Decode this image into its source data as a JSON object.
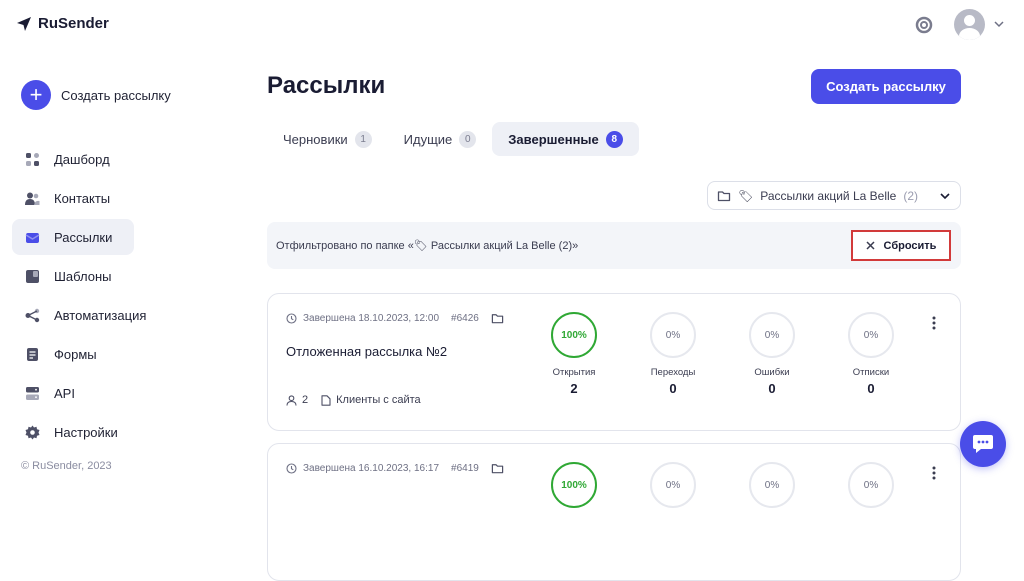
{
  "app": {
    "logo_text": "RuSender",
    "footer": "© RuSender, 2023"
  },
  "sidebar": {
    "create_label": "Создать рассылку",
    "items": [
      {
        "label": "Дашборд",
        "icon": "dashboard-icon"
      },
      {
        "label": "Контакты",
        "icon": "contacts-icon"
      },
      {
        "label": "Рассылки",
        "icon": "mailings-icon",
        "active": true
      },
      {
        "label": "Шаблоны",
        "icon": "templates-icon"
      },
      {
        "label": "Автоматизация",
        "icon": "automation-icon"
      },
      {
        "label": "Формы",
        "icon": "forms-icon"
      },
      {
        "label": "API",
        "icon": "api-icon"
      },
      {
        "label": "Настройки",
        "icon": "settings-icon"
      }
    ]
  },
  "main": {
    "title": "Рассылки",
    "create_button": "Создать рассылку",
    "tabs": [
      {
        "label": "Черновики",
        "count": "1"
      },
      {
        "label": "Идущие",
        "count": "0"
      },
      {
        "label": "Завершенные",
        "count": "8",
        "active": true
      }
    ],
    "folder_select": {
      "label": "Рассылки акций La Belle",
      "count": "(2)"
    },
    "filter_text": "Отфильтровано по папке «🏷 Рассылки акций La Belle (2)»",
    "reset_label": "Сбросить"
  },
  "campaigns": [
    {
      "status": "Завершена 18.10.2023, 12:00",
      "number": "#6426",
      "name": "Отложенная рассылка №2",
      "recipients": "2",
      "list": "Клиенты с сайта",
      "stats": [
        {
          "ring": "100%",
          "label": "Открытия",
          "value": "2"
        },
        {
          "ring": "0%",
          "label": "Переходы",
          "value": "0"
        },
        {
          "ring": "0%",
          "label": "Ошибки",
          "value": "0"
        },
        {
          "ring": "0%",
          "label": "Отписки",
          "value": "0"
        }
      ]
    },
    {
      "status": "Завершена 16.10.2023, 16:17",
      "number": "#6419",
      "stats": [
        {
          "ring": "100%"
        },
        {
          "ring": "0%"
        },
        {
          "ring": "0%"
        },
        {
          "ring": "0%"
        }
      ]
    }
  ],
  "colors": {
    "accent": "#4a4de8",
    "success": "#2fa834",
    "alert": "#d23a3a"
  }
}
